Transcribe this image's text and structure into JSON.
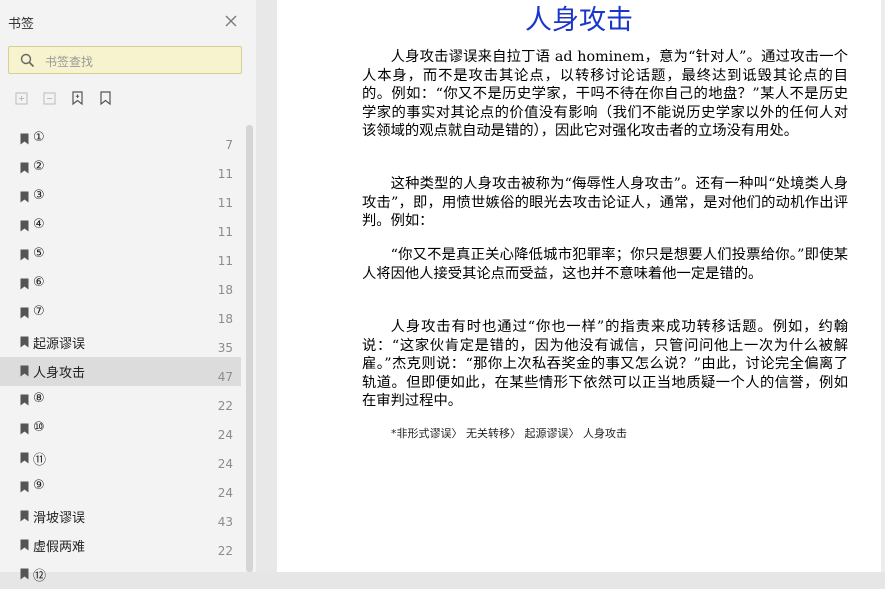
{
  "sidebar": {
    "title": "书签",
    "search_placeholder": "书签查找",
    "items": [
      {
        "label": "①",
        "page": "7"
      },
      {
        "label": "②",
        "page": "11"
      },
      {
        "label": "③",
        "page": "11"
      },
      {
        "label": "④",
        "page": "11"
      },
      {
        "label": "⑤",
        "page": "11"
      },
      {
        "label": "⑥",
        "page": "18"
      },
      {
        "label": "⑦",
        "page": "18"
      },
      {
        "label": "起源谬误",
        "page": "35"
      },
      {
        "label": "人身攻击",
        "page": "47",
        "selected": true
      },
      {
        "label": "⑧",
        "page": "22"
      },
      {
        "label": "⑩",
        "page": "24"
      },
      {
        "label": "⑪",
        "page": "24"
      },
      {
        "label": "⑨",
        "page": "24"
      },
      {
        "label": "滑坡谬误",
        "page": "43"
      },
      {
        "label": "虚假两难",
        "page": "22"
      },
      {
        "label": "⑫",
        "page": ""
      }
    ]
  },
  "document": {
    "title": "人身攻击",
    "paragraphs": [
      "人身攻击谬误来自拉丁语 ad hominem，意为“针对人”。通过攻击一个人本身，而不是攻击其论点，以转移讨论话题，最终达到诋毁其论点的目的。例如：“你又不是历史学家，干吗不待在你自己的地盘？”某人不是历史学家的事实对其论点的价值没有影响（我们不能说历史学家以外的任何人对该领域的观点就自动是错的），因此它对强化攻击者的立场没有用处。",
      "这种类型的人身攻击被称为“侮辱性人身攻击”。还有一种叫“处境类人身攻击”，即，用愤世嫉俗的眼光去攻击论证人，通常，是对他们的动机作出评判。例如：",
      "“你又不是真正关心降低城市犯罪率；你只是想要人们投票给你。”即使某人将因他人接受其论点而受益，这也并不意味着他一定是错的。",
      "人身攻击有时也通过“你也一样”的指责来成功转移话题。例如，约翰说：“这家伙肯定是错的，因为他没有诚信，只管问问他上一次为什么被解雇。”杰克则说：“那你上次私吞奖金的事又怎么说？”由此，讨论完全偏离了轨道。但即便如此，在某些情形下依然可以正当地质疑一个人的信誉，例如在审判过程中。"
    ],
    "breadcrumb": "*非形式谬误〉 无关转移〉 起源谬误〉 人身攻击"
  },
  "colors": {
    "title": "#1a36c8",
    "search_bg": "#f7f3cf",
    "selected_row": "#dcdcdc"
  }
}
